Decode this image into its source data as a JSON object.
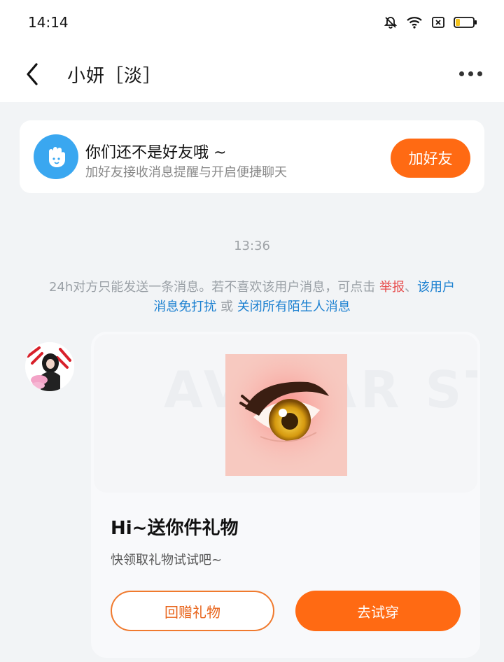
{
  "status_bar": {
    "time": "14:14",
    "icons": [
      "bell-off-icon",
      "wifi-icon",
      "sim-blocked-icon",
      "battery-icon"
    ],
    "battery_level": 0.25
  },
  "header": {
    "title": "小妍［淡］",
    "back_icon": "chevron-left-icon",
    "more_icon": "more-dots-icon"
  },
  "friend_prompt": {
    "icon": "hand-wave-icon",
    "title": "你们还不是好友哦 ~",
    "subtitle": "加好友接收消息提醒与开启便捷聊天",
    "button_label": "加好友",
    "accent_color": "#ff6a13"
  },
  "chat": {
    "timestamp": "13:36",
    "notice": {
      "prefix": "24h对方只能发送一条消息。若不喜欢该用户消息，可点击 ",
      "report": "举报",
      "sep1": "、",
      "mute_user_line1": "该用户",
      "mute_user_line2": "消息免打扰",
      "or": " 或 ",
      "close_strangers": "关闭所有陌生人消息"
    }
  },
  "gift_message": {
    "watermark": "AVATAR STORE",
    "title": "Hi~送你件礼物",
    "subtitle": "快领取礼物试试吧~",
    "return_button": "回赠礼物",
    "try_button": "去试穿"
  }
}
